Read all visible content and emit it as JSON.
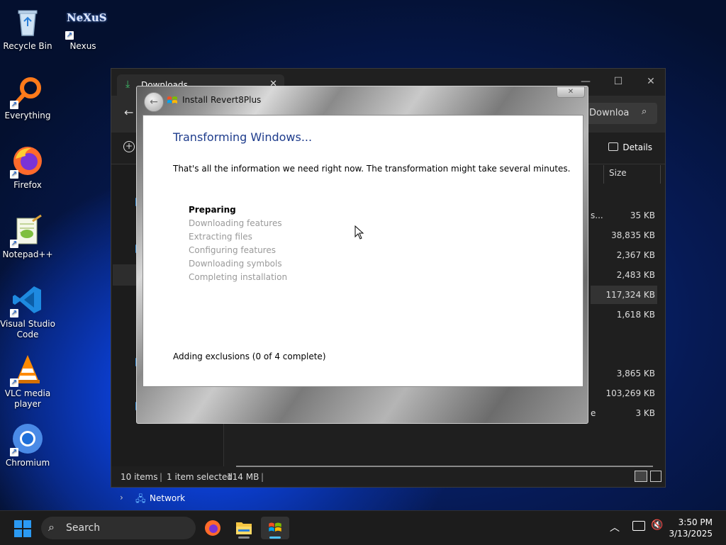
{
  "desktop": {
    "icons": [
      {
        "label": "Recycle Bin"
      },
      {
        "label": "Nexus",
        "logo_text": "NeXuS"
      },
      {
        "label": "Everything"
      },
      {
        "label": "Firefox"
      },
      {
        "label": "Notepad++"
      },
      {
        "label": "Visual Studio Code"
      },
      {
        "label": "VLC media player"
      },
      {
        "label": "Chromium"
      }
    ]
  },
  "explorer": {
    "tab_label": "Downloads",
    "search_text": "Downloa",
    "toolbar_details": "Details",
    "column_size": "Size",
    "name_fragments": {
      "row1": "s...",
      "row10": "e"
    },
    "sizes": [
      "35 KB",
      "38,835 KB",
      "2,367 KB",
      "2,483 KB",
      "117,324 KB",
      "1,618 KB",
      "3,865 KB",
      "103,269 KB",
      "3 KB"
    ],
    "nav_network": "Network",
    "status": {
      "items": "10 items",
      "selected": "1 item selected",
      "size": "114 MB"
    }
  },
  "dialog": {
    "title": "Install Revert8Plus",
    "heading": "Transforming Windows...",
    "description": "That's all the information we need right now. The transformation might take several minutes.",
    "steps": [
      "Preparing",
      "Downloading features",
      "Extracting files",
      "Configuring features",
      "Downloading symbols",
      "Completing installation"
    ],
    "active_step": "Preparing",
    "progress_text": "Adding exclusions (0 of 4 complete)"
  },
  "taskbar": {
    "search_label": "Search",
    "time": "3:50 PM",
    "date": "3/13/2025"
  },
  "colors": {
    "heading_blue": "#1e3c8c",
    "accent_blue": "#3a8fd6"
  },
  "icons": [
    "recycle-bin-icon",
    "nexus-icon",
    "everything-icon",
    "firefox-icon",
    "notepadpp-icon",
    "vscode-icon",
    "vlc-icon",
    "chromium-icon"
  ]
}
